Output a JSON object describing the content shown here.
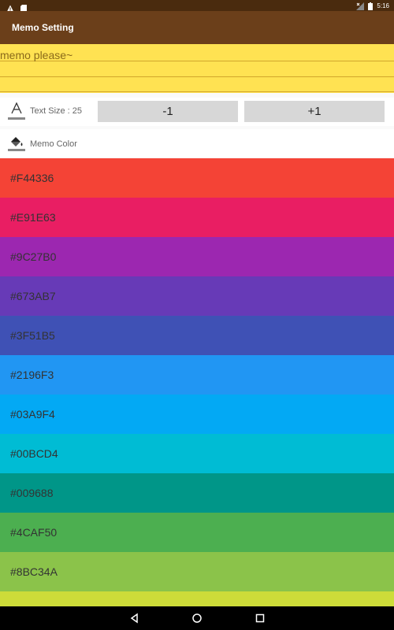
{
  "status_bar": {
    "time": "5:16",
    "icons": [
      "warning-icon",
      "sd-card-icon",
      "no-signal-icon",
      "battery-icon"
    ]
  },
  "app_bar": {
    "title": "Memo Setting"
  },
  "memo": {
    "text": "memo please~",
    "background": "#FFE252"
  },
  "text_size": {
    "label": "Text Size : 25",
    "minus_label": "-1",
    "plus_label": "+1"
  },
  "memo_color": {
    "label": "Memo Color",
    "options": [
      {
        "label": "#F44336",
        "color": "#F44336"
      },
      {
        "label": "#E91E63",
        "color": "#E91E63"
      },
      {
        "label": "#9C27B0",
        "color": "#9C27B0"
      },
      {
        "label": "#673AB7",
        "color": "#673AB7"
      },
      {
        "label": "#3F51B5",
        "color": "#3F51B5"
      },
      {
        "label": "#2196F3",
        "color": "#2196F3"
      },
      {
        "label": "#03A9F4",
        "color": "#03A9F4"
      },
      {
        "label": "#00BCD4",
        "color": "#00BCD4"
      },
      {
        "label": "#009688",
        "color": "#009688"
      },
      {
        "label": "#4CAF50",
        "color": "#4CAF50"
      },
      {
        "label": "#8BC34A",
        "color": "#8BC34A"
      },
      {
        "label": "",
        "color": "#CDDC39"
      }
    ]
  },
  "nav_bar": {
    "icons": [
      "back-icon",
      "home-icon",
      "recents-icon"
    ]
  }
}
